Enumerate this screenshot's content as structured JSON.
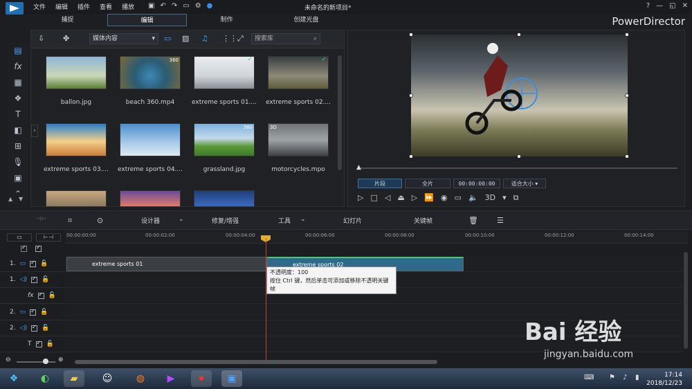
{
  "app": {
    "title": "未命名的新项目*",
    "brand": "PowerDirector"
  },
  "menu": [
    "文件",
    "编辑",
    "插件",
    "查看",
    "播放"
  ],
  "modes": [
    {
      "label": "捕捉",
      "active": false
    },
    {
      "label": "编辑",
      "active": true
    },
    {
      "label": "制作",
      "active": false
    },
    {
      "label": "创建光盘",
      "active": false
    }
  ],
  "window_controls": [
    "?",
    "—",
    "◱",
    "✕"
  ],
  "library": {
    "content_dropdown": "媒体内容",
    "search_placeholder": "搜索库",
    "items": [
      {
        "name": "ballon.jpg",
        "badge": ""
      },
      {
        "name": "beach 360.mp4",
        "badge": "360"
      },
      {
        "name": "extreme sports 01....",
        "badge": "✓"
      },
      {
        "name": "extreme sports 02....",
        "badge": "✓"
      },
      {
        "name": "extreme sports 03....",
        "badge": ""
      },
      {
        "name": "extreme sports 04....",
        "badge": ""
      },
      {
        "name": "grassland.jpg",
        "badge": "360"
      },
      {
        "name": "motorcycles.mpo",
        "badge": "3D"
      }
    ]
  },
  "preview": {
    "clip_btn": "片段",
    "full_btn": "全片",
    "timecode": "00:00:00:00",
    "fit": "适合大小",
    "mode3d": "3D"
  },
  "toolbar": {
    "designer": "设计器",
    "repair": "修复/增强",
    "tools": "工具",
    "slideshow": "幻灯片",
    "keyframe": "关键帧"
  },
  "ruler": {
    "ticks": [
      "00:00:00:00",
      "00:00:02:00",
      "00:00:04:00",
      "00:00:06:00",
      "00:00:08:00",
      "00:00:10:00",
      "00:00:12:00",
      "00:00:14:00"
    ]
  },
  "tracks": [
    {
      "label": "1.",
      "icon": "video-track-icon"
    },
    {
      "label": "1.",
      "icon": "audio-track-icon"
    },
    {
      "label": "",
      "icon": "fx-track-icon"
    },
    {
      "label": "2.",
      "icon": "video-track-icon"
    },
    {
      "label": "2.",
      "icon": "audio-track-icon"
    },
    {
      "label": "",
      "icon": "title-track-icon"
    }
  ],
  "clips": {
    "clip1": "extreme sports 01",
    "clip2": "extreme sports 02"
  },
  "tooltip": {
    "line1": "不透明度：100",
    "line2": "按住 Ctrl 键，然后单击可添加或移除不透明关键帧"
  },
  "taskbar": {
    "time": "17:14",
    "date": "2018/12/23"
  },
  "watermark": {
    "main": "Bai 经验",
    "sub": "jingyan.baidu.com"
  }
}
